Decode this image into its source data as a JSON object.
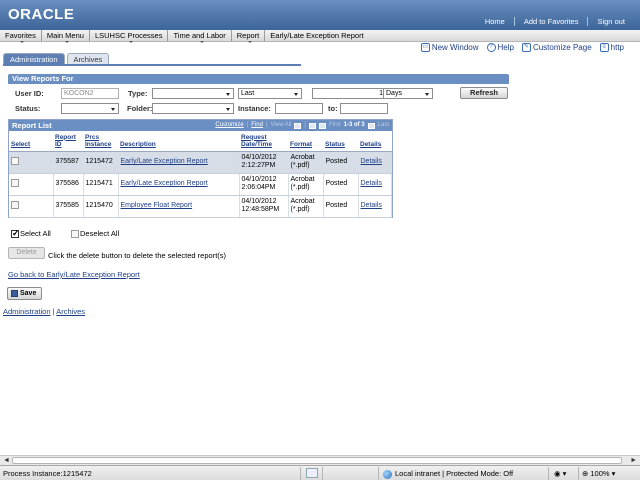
{
  "brand": {
    "logo": "ORACLE"
  },
  "top_links": [
    "Home",
    "Add to Favorites",
    "Sign out"
  ],
  "menu": [
    "Favorites",
    "Main Menu",
    "LSUHSC Processes",
    "Time and Labor",
    "Report",
    "Early/Late Exception Report"
  ],
  "page_links": {
    "new_window": "New Window",
    "help": "Help",
    "customize": "Customize Page",
    "http": "http"
  },
  "tabs": [
    {
      "label": "Administration",
      "active": true
    },
    {
      "label": "Archives",
      "active": false
    }
  ],
  "view_reports": {
    "title": "View Reports For",
    "user_id_label": "User ID:",
    "user_id_value": "KOCON2",
    "type_label": "Type:",
    "type_value": "",
    "last_select": "Last",
    "last_value": "1",
    "days_select": "Days",
    "refresh": "Refresh",
    "status_label": "Status:",
    "status_value": "",
    "folder_label": "Folder:",
    "folder_value": "",
    "instance_label": "Instance:",
    "instance_value": "",
    "to_label": "to:",
    "to_value": ""
  },
  "report_list": {
    "title": "Report List",
    "customize": "Customize",
    "find": "Find",
    "view_all": "View All",
    "first": "First",
    "range": "1-3 of 3",
    "last": "Last",
    "columns": [
      "Select",
      "Report ID",
      "Prcs Instance",
      "Description",
      "Request Date/Time",
      "Format",
      "Status",
      "Details"
    ],
    "rows": [
      {
        "report_id": "375587",
        "instance": "1215472",
        "description": "Early/Late Exception Report",
        "date": "04/10/2012",
        "time": "2:12:27PM",
        "format": "Acrobat",
        "format_ext": "(*.pdf)",
        "status": "Posted",
        "details": "Details"
      },
      {
        "report_id": "375586",
        "instance": "1215471",
        "description": "Early/Late Exception Report",
        "date": "04/10/2012",
        "time": "2:06:04PM",
        "format": "Acrobat",
        "format_ext": "(*.pdf)",
        "status": "Posted",
        "details": "Details"
      },
      {
        "report_id": "375585",
        "instance": "1215470",
        "description": "Employee Float Report",
        "date": "04/10/2012",
        "time": "12:48:58PM",
        "format": "Acrobat",
        "format_ext": "(*.pdf)",
        "status": "Posted",
        "details": "Details"
      }
    ]
  },
  "select_all": "Select All",
  "deselect_all": "Deselect All",
  "delete_button": "Delete",
  "delete_text": "Click the delete button to delete the selected report(s)",
  "go_back": "Go back to Early/Late Exception Report",
  "save": "Save",
  "footer_links": {
    "administration": "Administration",
    "separator": "|",
    "archives": "Archives"
  },
  "statusbar": {
    "process": "Process Instance:1215472",
    "zone": "Local intranet | Protected Mode: Off",
    "zoom": "100%"
  }
}
